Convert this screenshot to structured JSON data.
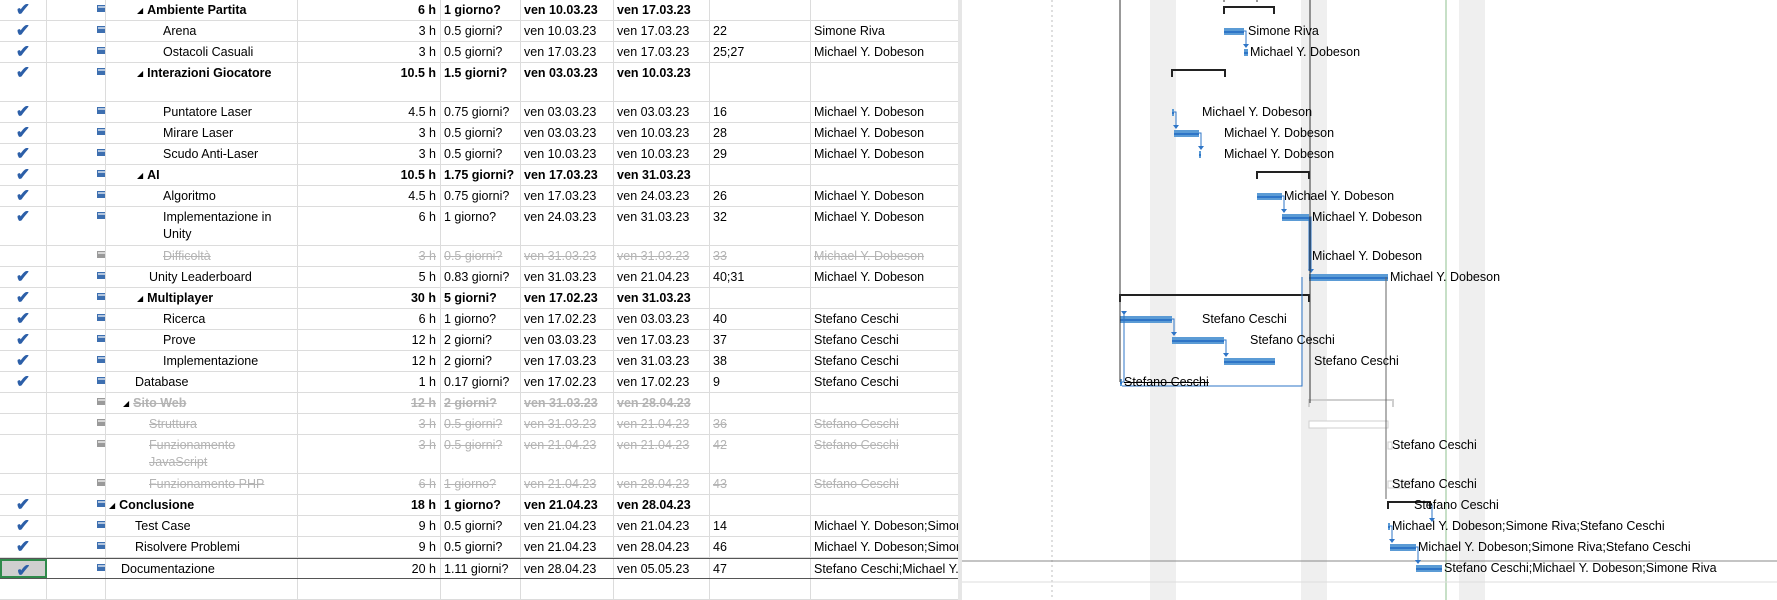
{
  "tasks": [
    {
      "name": "Ambiente Partita",
      "work": "6 h",
      "duration": "1 giorno?",
      "start": "ven 10.03.23",
      "finish": "ven 17.03.23",
      "pred": "",
      "resource": "",
      "level": 2,
      "summary": true,
      "inactive": false,
      "done": true,
      "tall": false
    },
    {
      "name": "Arena",
      "work": "3 h",
      "duration": "0.5 giorni?",
      "start": "ven 10.03.23",
      "finish": "ven 17.03.23",
      "pred": "22",
      "resource": "Simone Riva",
      "level": 3,
      "summary": false,
      "inactive": false,
      "done": true,
      "tall": false
    },
    {
      "name": "Ostacoli Casuali",
      "work": "3 h",
      "duration": "0.5 giorni?",
      "start": "ven 17.03.23",
      "finish": "ven 17.03.23",
      "pred": "25;27",
      "resource": "Michael Y. Dobeson",
      "level": 3,
      "summary": false,
      "inactive": false,
      "done": true,
      "tall": false
    },
    {
      "name": "Interazioni Giocatore",
      "work": "10.5 h",
      "duration": "1.5 giorni?",
      "start": "ven 03.03.23",
      "finish": "ven 10.03.23",
      "pred": "",
      "resource": "",
      "level": 2,
      "summary": true,
      "inactive": false,
      "done": true,
      "tall": true
    },
    {
      "name": "Puntatore Laser",
      "work": "4.5 h",
      "duration": "0.75 giorni?",
      "start": "ven 03.03.23",
      "finish": "ven 03.03.23",
      "pred": "16",
      "resource": "Michael Y. Dobeson",
      "level": 3,
      "summary": false,
      "inactive": false,
      "done": true,
      "tall": false
    },
    {
      "name": "Mirare Laser",
      "work": "3 h",
      "duration": "0.5 giorni?",
      "start": "ven 03.03.23",
      "finish": "ven 10.03.23",
      "pred": "28",
      "resource": "Michael Y. Dobeson",
      "level": 3,
      "summary": false,
      "inactive": false,
      "done": true,
      "tall": false
    },
    {
      "name": "Scudo Anti-Laser",
      "work": "3 h",
      "duration": "0.5 giorni?",
      "start": "ven 10.03.23",
      "finish": "ven 10.03.23",
      "pred": "29",
      "resource": "Michael Y. Dobeson",
      "level": 3,
      "summary": false,
      "inactive": false,
      "done": true,
      "tall": false
    },
    {
      "name": "AI",
      "work": "10.5 h",
      "duration": "1.75 giorni?",
      "start": "ven 17.03.23",
      "finish": "ven 31.03.23",
      "pred": "",
      "resource": "",
      "level": 2,
      "summary": true,
      "inactive": false,
      "done": true,
      "tall": false
    },
    {
      "name": "Algoritmo",
      "work": "4.5 h",
      "duration": "0.75 giorni?",
      "start": "ven 17.03.23",
      "finish": "ven 24.03.23",
      "pred": "26",
      "resource": "Michael Y. Dobeson",
      "level": 3,
      "summary": false,
      "inactive": false,
      "done": true,
      "tall": false
    },
    {
      "name": "Implementazione in Unity",
      "work": "6 h",
      "duration": "1 giorno?",
      "start": "ven 24.03.23",
      "finish": "ven 31.03.23",
      "pred": "32",
      "resource": "Michael Y. Dobeson",
      "level": 3,
      "summary": false,
      "inactive": false,
      "done": true,
      "tall": true
    },
    {
      "name": "Difficoltà",
      "work": "3 h",
      "duration": "0.5 giorni?",
      "start": "ven 31.03.23",
      "finish": "ven 31.03.23",
      "pred": "33",
      "resource": "Michael Y. Dobeson",
      "level": 3,
      "summary": false,
      "inactive": true,
      "done": false,
      "tall": false
    },
    {
      "name": "Unity Leaderboard",
      "work": "5 h",
      "duration": "0.83 giorni?",
      "start": "ven 31.03.23",
      "finish": "ven 21.04.23",
      "pred": "40;31",
      "resource": "Michael Y. Dobeson",
      "level": 2,
      "summary": false,
      "inactive": false,
      "done": true,
      "tall": false
    },
    {
      "name": "Multiplayer",
      "work": "30 h",
      "duration": "5 giorni?",
      "start": "ven 17.02.23",
      "finish": "ven 31.03.23",
      "pred": "",
      "resource": "",
      "level": 2,
      "summary": true,
      "inactive": false,
      "done": true,
      "tall": false
    },
    {
      "name": "Ricerca",
      "work": "6 h",
      "duration": "1 giorno?",
      "start": "ven 17.02.23",
      "finish": "ven 03.03.23",
      "pred": "40",
      "resource": "Stefano Ceschi",
      "level": 3,
      "summary": false,
      "inactive": false,
      "done": true,
      "tall": false
    },
    {
      "name": "Prove",
      "work": "12 h",
      "duration": "2 giorni?",
      "start": "ven 03.03.23",
      "finish": "ven 17.03.23",
      "pred": "37",
      "resource": "Stefano Ceschi",
      "level": 3,
      "summary": false,
      "inactive": false,
      "done": true,
      "tall": false
    },
    {
      "name": "Implementazione",
      "work": "12 h",
      "duration": "2 giorni?",
      "start": "ven 17.03.23",
      "finish": "ven 31.03.23",
      "pred": "38",
      "resource": "Stefano Ceschi",
      "level": 3,
      "summary": false,
      "inactive": false,
      "done": true,
      "tall": false
    },
    {
      "name": "Database",
      "work": "1 h",
      "duration": "0.17 giorni?",
      "start": "ven 17.02.23",
      "finish": "ven 17.02.23",
      "pred": "9",
      "resource": "Stefano Ceschi",
      "level": 1,
      "summary": false,
      "inactive": false,
      "done": true,
      "tall": false
    },
    {
      "name": "Sito Web",
      "work": "12 h",
      "duration": "2 giorni?",
      "start": "ven 31.03.23",
      "finish": "ven 28.04.23",
      "pred": "",
      "resource": "",
      "level": 1,
      "summary": true,
      "inactive": true,
      "done": false,
      "tall": false
    },
    {
      "name": "Struttura",
      "work": "3 h",
      "duration": "0.5 giorni?",
      "start": "ven 31.03.23",
      "finish": "ven 21.04.23",
      "pred": "36",
      "resource": "Stefano Ceschi",
      "level": 2,
      "summary": false,
      "inactive": true,
      "done": false,
      "tall": false
    },
    {
      "name": "Funzionamento JavaScript",
      "work": "3 h",
      "duration": "0.5 giorni?",
      "start": "ven 21.04.23",
      "finish": "ven 21.04.23",
      "pred": "42",
      "resource": "Stefano Ceschi",
      "level": 2,
      "summary": false,
      "inactive": true,
      "done": false,
      "tall": true
    },
    {
      "name": "Funzionamento PHP",
      "work": "6 h",
      "duration": "1 giorno?",
      "start": "ven 21.04.23",
      "finish": "ven 28.04.23",
      "pred": "43",
      "resource": "Stefano Ceschi",
      "level": 2,
      "summary": false,
      "inactive": true,
      "done": false,
      "tall": false
    },
    {
      "name": "Conclusione",
      "work": "18 h",
      "duration": "1 giorno?",
      "start": "ven 21.04.23",
      "finish": "ven 28.04.23",
      "pred": "",
      "resource": "",
      "level": 0,
      "summary": true,
      "inactive": false,
      "done": true,
      "tall": false
    },
    {
      "name": "Test Case",
      "work": "9 h",
      "duration": "0.5 giorni?",
      "start": "ven 21.04.23",
      "finish": "ven 21.04.23",
      "pred": "14",
      "resource": "Michael Y. Dobeson;Simone Riva;Stefano Ceschi",
      "level": 1,
      "summary": false,
      "inactive": false,
      "done": true,
      "tall": false
    },
    {
      "name": "Risolvere Problemi",
      "work": "9 h",
      "duration": "0.5 giorni?",
      "start": "ven 21.04.23",
      "finish": "ven 28.04.23",
      "pred": "46",
      "resource": "Michael Y. Dobeson;Simone Riva;Stefano Ceschi",
      "level": 1,
      "summary": false,
      "inactive": false,
      "done": true,
      "tall": false
    },
    {
      "name": "Documentazione",
      "work": "20 h",
      "duration": "1.11 giorni?",
      "start": "ven 28.04.23",
      "finish": "ven 05.05.23",
      "pred": "47",
      "resource": "Stefano Ceschi;Michael Y. Dobeson;Simone Riva",
      "level": 0,
      "summary": false,
      "inactive": false,
      "done": true,
      "tall": false,
      "selected": true
    }
  ],
  "gantt_labels": [
    "Simone Riva",
    "Michael Y. Dobeson",
    "Michael Y. Dobeson",
    "Michael Y. Dobeson",
    "Michael Y. Dobeson",
    "Michael Y. Dobeson",
    "Michael Y. Dobeson",
    "Michael Y. Dobeson",
    "Michael Y. Dobeson",
    "Stefano Ceschi",
    "Stefano Ceschi",
    "Stefano Ceschi",
    "Stefano Ceschi",
    "Stefano Ceschi",
    "Stefano Ceschi",
    "Stefano Ceschi",
    "Michael Y. Dobeson;Simone Riva;Stefano Ceschi",
    "Michael Y. Dobeson;Simone Riva;Stefano Ceschi",
    "Stefano Ceschi;Michael Y. Dobeson;Simone Riva"
  ],
  "colors": {
    "check": "#2c5fa8",
    "bar": "#5b9bd5",
    "bar_dark": "#2e75c7",
    "summary": "#222222",
    "inactive": "#b4b4b4",
    "weekend": "#efefef"
  }
}
